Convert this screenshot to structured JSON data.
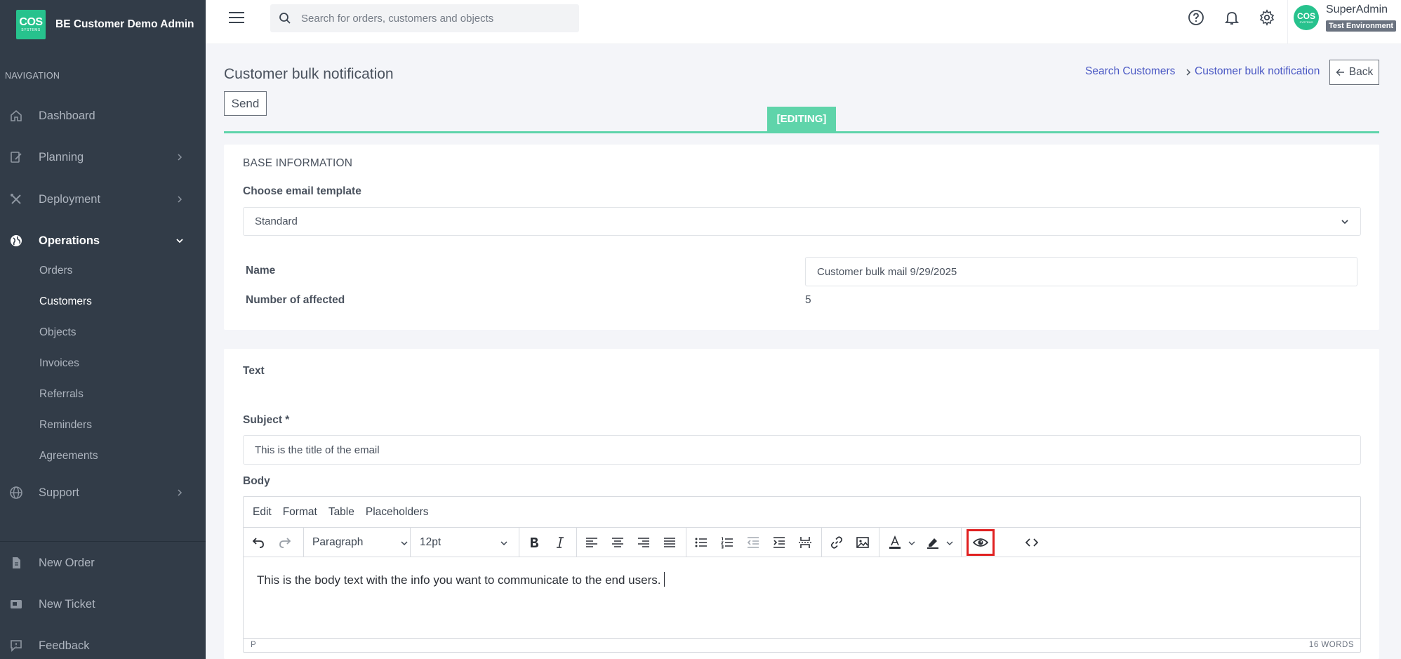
{
  "app": {
    "logo_big": "COS",
    "logo_small": "SYSTEMS",
    "brand": "BE Customer Demo Admin"
  },
  "nav": {
    "heading": "NAVIGATION",
    "dashboard": "Dashboard",
    "planning": "Planning",
    "deployment": "Deployment",
    "operations": "Operations",
    "operations_sub": {
      "orders": "Orders",
      "customers": "Customers",
      "objects": "Objects",
      "invoices": "Invoices",
      "referrals": "Referrals",
      "reminders": "Reminders",
      "agreements": "Agreements"
    },
    "support": "Support",
    "new_order": "New Order",
    "new_ticket": "New Ticket",
    "feedback": "Feedback"
  },
  "topbar": {
    "search_placeholder": "Search for orders, customers and objects",
    "user_name": "SuperAdmin",
    "environment": "Test Environment"
  },
  "page": {
    "title": "Customer bulk notification",
    "send": "Send",
    "breadcrumb": [
      "Search Customers",
      "Customer bulk notification"
    ],
    "back": "Back",
    "mode_badge": "[EDITING]"
  },
  "base_info": {
    "title": "BASE INFORMATION",
    "template_label": "Choose email template",
    "template_value": "Standard",
    "name_label": "Name",
    "name_value": "Customer bulk mail 9/29/2025",
    "affected_label": "Number of affected",
    "affected_value": "5"
  },
  "text_section": {
    "title": "Text",
    "subject_label": "Subject *",
    "subject_value": "This is the title of the email",
    "body_label": "Body"
  },
  "editor": {
    "menu": [
      "Edit",
      "Format",
      "Table",
      "Placeholders"
    ],
    "block_format": "Paragraph",
    "font_size": "12pt",
    "body_text": "This is the body text with the info you want to communicate to the end users.",
    "status_path": "P",
    "word_count": "16 WORDS"
  },
  "colors": {
    "sidebar": "#323c48",
    "accent": "#27c28d",
    "link": "#4a58c4",
    "highlight": "#e02020"
  }
}
